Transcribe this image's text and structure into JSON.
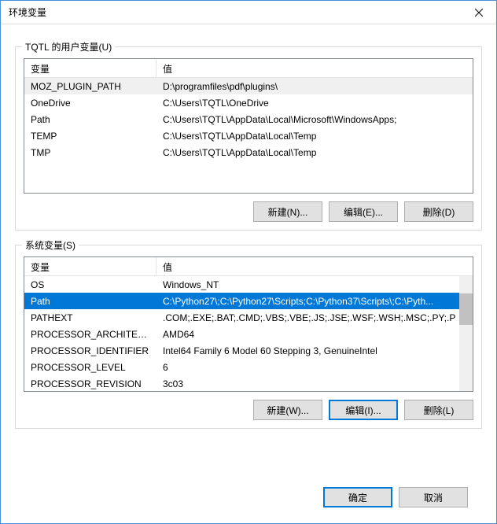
{
  "window": {
    "title": "环境变量"
  },
  "userGroup": {
    "label": "TQTL 的用户变量(U)",
    "headers": {
      "var": "变量",
      "val": "值"
    },
    "rows": [
      {
        "var": "MOZ_PLUGIN_PATH",
        "val": "D:\\programfiles\\pdf\\plugins\\",
        "selected": true
      },
      {
        "var": "OneDrive",
        "val": "C:\\Users\\TQTL\\OneDrive"
      },
      {
        "var": "Path",
        "val": "C:\\Users\\TQTL\\AppData\\Local\\Microsoft\\WindowsApps;"
      },
      {
        "var": "TEMP",
        "val": "C:\\Users\\TQTL\\AppData\\Local\\Temp"
      },
      {
        "var": "TMP",
        "val": "C:\\Users\\TQTL\\AppData\\Local\\Temp"
      }
    ],
    "buttons": {
      "new": "新建(N)...",
      "edit": "编辑(E)...",
      "del": "删除(D)"
    }
  },
  "sysGroup": {
    "label": "系统变量(S)",
    "headers": {
      "var": "变量",
      "val": "值"
    },
    "rows": [
      {
        "var": "OS",
        "val": "Windows_NT"
      },
      {
        "var": "Path",
        "val": "C:\\Python27\\;C:\\Python27\\Scripts;C:\\Python37\\Scripts\\;C:\\Pyth...",
        "selected": true
      },
      {
        "var": "PATHEXT",
        "val": ".COM;.EXE;.BAT;.CMD;.VBS;.VBE;.JS;.JSE;.WSF;.WSH;.MSC;.PY;.P"
      },
      {
        "var": "PROCESSOR_ARCHITECT",
        "val": "AMD64"
      },
      {
        "var": "PROCESSOR_IDENTIFIER",
        "val": "Intel64 Family 6 Model 60 Stepping 3, GenuineIntel"
      },
      {
        "var": "PROCESSOR_LEVEL",
        "val": "6"
      },
      {
        "var": "PROCESSOR_REVISION",
        "val": "3c03"
      }
    ],
    "buttons": {
      "new": "新建(W)...",
      "edit": "编辑(I)...",
      "del": "删除(L)"
    }
  },
  "footer": {
    "ok": "确定",
    "cancel": "取消"
  }
}
